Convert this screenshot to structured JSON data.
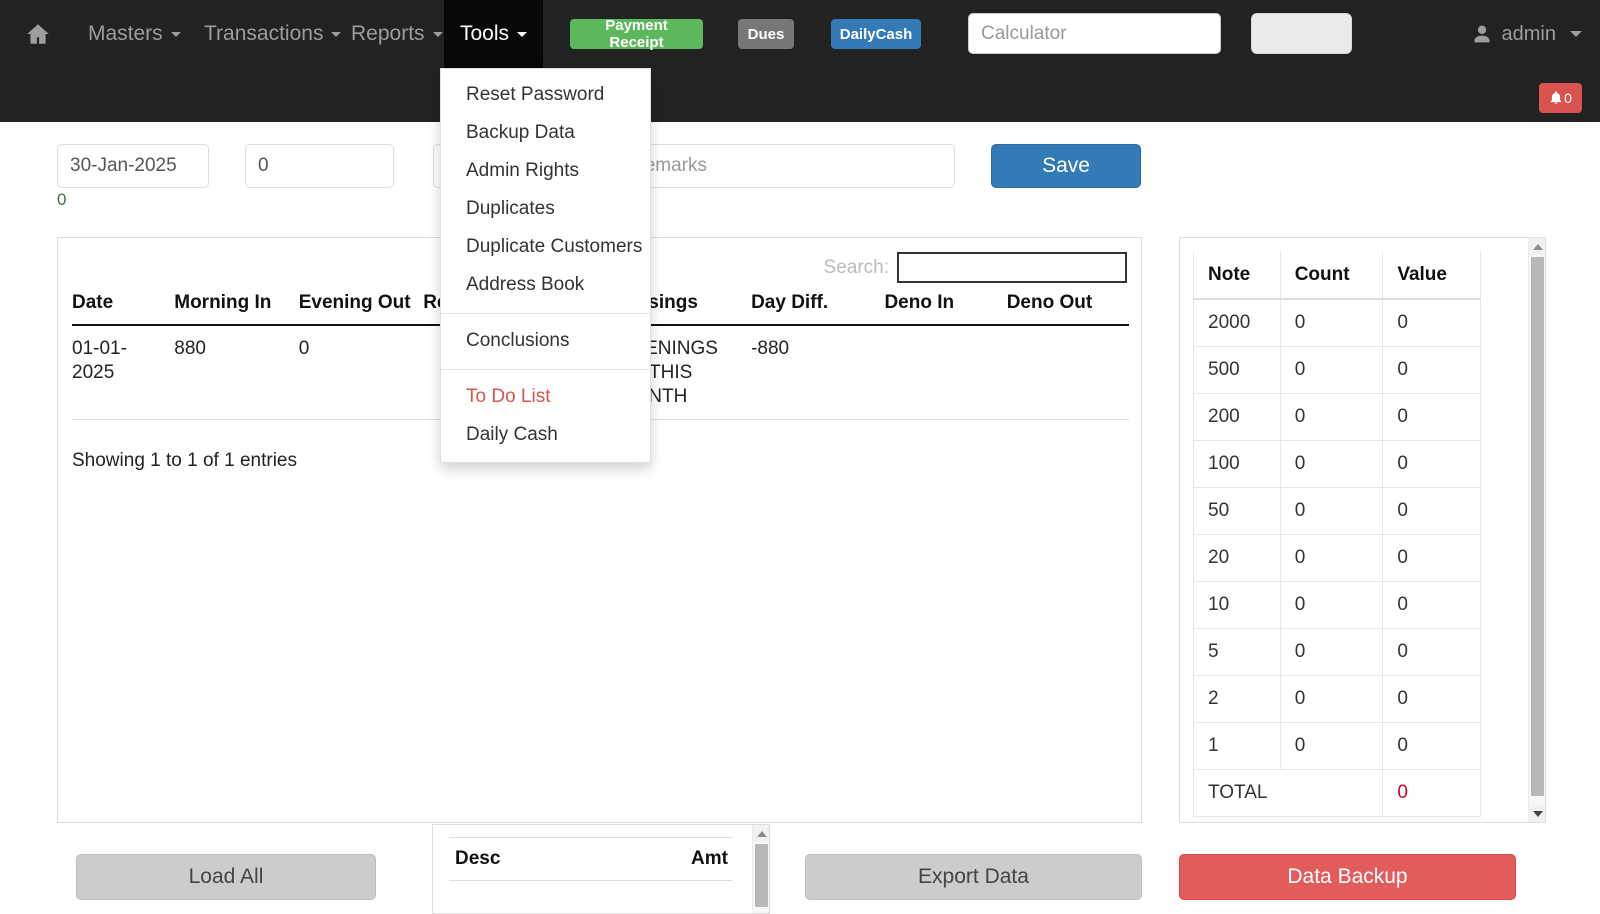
{
  "navbar": {
    "home_icon": "home-icon",
    "menus": [
      {
        "id": "masters",
        "label": "Masters"
      },
      {
        "id": "transactions",
        "label": "Transactions"
      },
      {
        "id": "reports",
        "label": "Reports"
      },
      {
        "id": "tools",
        "label": "Tools"
      }
    ],
    "buttons": {
      "payment_receipt": "Payment Receipt",
      "dues": "Dues",
      "dailycash": "DailyCash"
    },
    "calculator": {
      "value": "",
      "placeholder": "Calculator"
    },
    "user": {
      "name": "admin",
      "icon": "user-icon"
    },
    "notification": {
      "count": "0",
      "icon": "bell-icon"
    },
    "colors": {
      "bg": "#222222",
      "open_bg": "#080808",
      "link": "#9d9d9d",
      "success": "#5cb85c",
      "secondary": "#777777",
      "primary": "#337ab7",
      "danger": "#d9534f"
    }
  },
  "tools_dropdown": {
    "open": true,
    "group1": [
      "Reset Password",
      "Backup Data",
      "Admin Rights",
      "Duplicates",
      "Duplicate Customers",
      "Address Book"
    ],
    "group2": [
      "Conclusions"
    ],
    "group3": [
      {
        "label": "To Do List",
        "color": "#d9534f"
      },
      {
        "label": "Daily Cash",
        "color": "#333333"
      }
    ]
  },
  "form": {
    "date": {
      "value": "30-Jan-2025",
      "placeholder": ""
    },
    "amount": {
      "value": "0",
      "placeholder": ""
    },
    "third": {
      "value": "",
      "placeholder": ""
    },
    "remarks": {
      "value": "",
      "placeholder": "Remarks"
    },
    "helper_zero": "0",
    "helper_color": "#3c763d",
    "save_label": "Save"
  },
  "table": {
    "search_label": "Search:",
    "search_value": "",
    "headers": [
      "Date",
      "Morning In",
      "Evening Out",
      "Remarks",
      "Closings",
      "Day Diff.",
      "Deno In",
      "Deno Out"
    ],
    "rows": [
      {
        "date": "01-01-2025",
        "morning_in": "880",
        "evening_out": "0",
        "remarks": "",
        "closings": "OPENINGS OF THIS MONTH",
        "day_diff": "-880",
        "deno_in": "",
        "deno_out": ""
      }
    ],
    "info": "Showing 1 to 1 of 1 entries"
  },
  "denomination": {
    "headers": [
      "Note",
      "Count",
      "Value"
    ],
    "rows": [
      {
        "note": "2000",
        "count": "0",
        "value": "0"
      },
      {
        "note": "500",
        "count": "0",
        "value": "0"
      },
      {
        "note": "200",
        "count": "0",
        "value": "0"
      },
      {
        "note": "100",
        "count": "0",
        "value": "0"
      },
      {
        "note": "50",
        "count": "0",
        "value": "0"
      },
      {
        "note": "20",
        "count": "0",
        "value": "0"
      },
      {
        "note": "10",
        "count": "0",
        "value": "0"
      },
      {
        "note": "5",
        "count": "0",
        "value": "0"
      },
      {
        "note": "2",
        "count": "0",
        "value": "0"
      },
      {
        "note": "1",
        "count": "0",
        "value": "0"
      }
    ],
    "total_label": "TOTAL",
    "total_value": "0",
    "total_color": "#d0021b"
  },
  "desc_panel": {
    "headers": {
      "desc": "Desc",
      "amt": "Amt"
    }
  },
  "bottom_buttons": {
    "load_all": "Load All",
    "export_data": "Export Data",
    "data_backup": "Data Backup",
    "data_backup_color": "#e25c5c"
  }
}
